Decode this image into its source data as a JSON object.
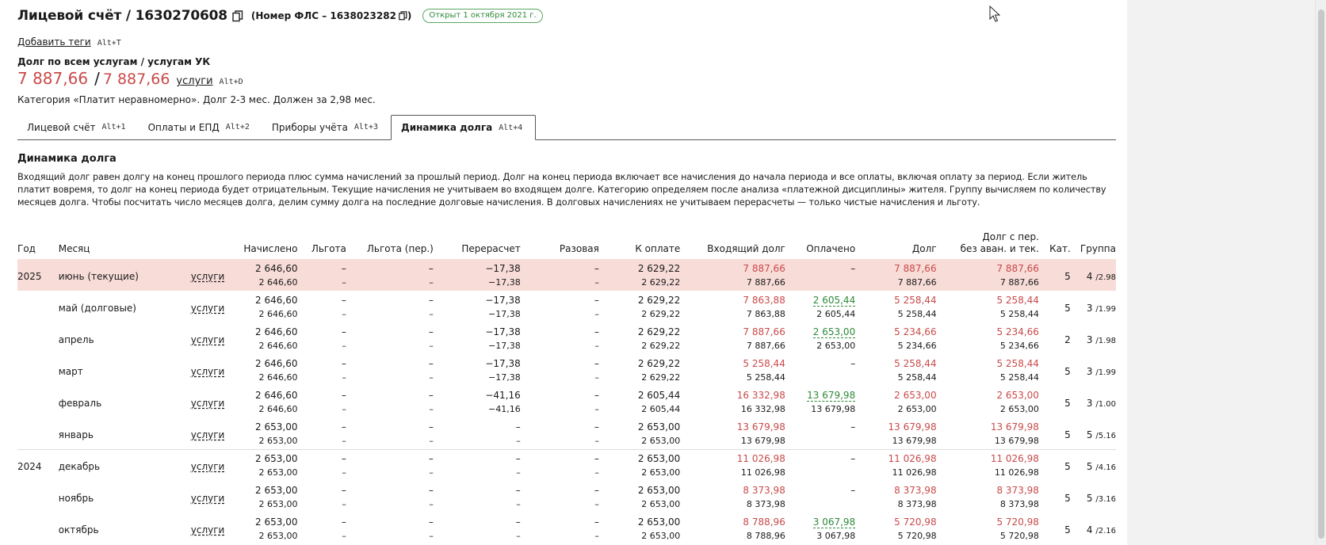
{
  "header": {
    "title": "Лицевой счёт / 1630270608",
    "fls_label": "(Номер ФЛС – 1638023282",
    "fls_close": ")",
    "opened_badge": "Открыт 1 октября 2021 г."
  },
  "tags": {
    "add_label": "Добавить теги",
    "hotkey": "Alt+T"
  },
  "debt": {
    "label": "Долг по всем услугам / услугам УК",
    "total": "7 887,66",
    "sep": "/",
    "uk": "7 887,66",
    "services_link": "услуги",
    "hotkey": "Alt+D",
    "category_text": "Категория «Платит неравномерно». Долг 2-3 мес. Должен за 2,98 мес."
  },
  "tabs": [
    {
      "label": "Лицевой счёт",
      "hotkey": "Alt+1"
    },
    {
      "label": "Оплаты и ЕПД",
      "hotkey": "Alt+2"
    },
    {
      "label": "Приборы учёта",
      "hotkey": "Alt+3"
    },
    {
      "label": "Динамика долга",
      "hotkey": "Alt+4"
    }
  ],
  "section": {
    "title": "Динамика долга",
    "description": "Входящий долг равен долгу на конец прошлого периода плюс сумма начислений за прошлый период. Долг на конец периода включает все начисления до начала периода и все оплаты, включая оплату за период. Если житель платит вовремя, то долг на конец периода будет отрицательным. Текущие начисления не учитываем во входящем долге. Категорию определяем после анализа «платежной дисциплины» жителя. Группу вычисляем по количеству месяцев долга. Чтобы посчитать число месяцев долга, делим сумму долга на последние долговые начисления. В долговых начислениях не учитываем перерасчеты — только чистые начисления и льготу."
  },
  "table": {
    "headers": {
      "year": "Год",
      "month": "Месяц",
      "charged": "Начислено",
      "benefit": "Льгота",
      "benefit_rec": "Льгота (пер.)",
      "recalc": "Перерасчет",
      "onetime": "Разовая",
      "to_pay": "К оплате",
      "incoming": "Входящий долг",
      "paid": "Оплачено",
      "debt": "Долг",
      "debt_adj_1": "Долг с пер.",
      "debt_adj_2": "без аван. и тек.",
      "cat": "Кат.",
      "group": "Группа"
    },
    "rows": [
      {
        "year": "2025",
        "month": "июнь (текущие)",
        "svc": "услуги",
        "charged": "2 646,60",
        "benefit": "–",
        "benefit_rec": "–",
        "recalc": "−17,38",
        "onetime": "–",
        "to_pay": "2 629,22",
        "incoming": "7 887,66",
        "paid": "–",
        "debt": "7 887,66",
        "debt_adj": "7 887,66",
        "cat": "5",
        "group_n": "4",
        "group_v": "/2.98",
        "sub": {
          "charged": "2 646,60",
          "benefit": "–",
          "benefit_rec": "–",
          "recalc": "−17,38",
          "onetime": "–",
          "to_pay": "2 629,22",
          "incoming": "7 887,66",
          "paid": "",
          "debt": "7 887,66",
          "debt_adj": "7 887,66"
        }
      },
      {
        "year": "",
        "month": "май (долговые)",
        "svc": "услуги",
        "charged": "2 646,60",
        "benefit": "–",
        "benefit_rec": "–",
        "recalc": "−17,38",
        "onetime": "–",
        "to_pay": "2 629,22",
        "incoming": "7 863,88",
        "paid": "2 605,44",
        "debt": "5 258,44",
        "debt_adj": "5 258,44",
        "cat": "5",
        "group_n": "3",
        "group_v": "/1.99",
        "sub": {
          "charged": "2 646,60",
          "benefit": "–",
          "benefit_rec": "–",
          "recalc": "−17,38",
          "onetime": "–",
          "to_pay": "2 629,22",
          "incoming": "7 863,88",
          "paid": "2 605,44",
          "debt": "5 258,44",
          "debt_adj": "5 258,44"
        }
      },
      {
        "year": "",
        "month": "апрель",
        "svc": "услуги",
        "charged": "2 646,60",
        "benefit": "–",
        "benefit_rec": "–",
        "recalc": "−17,38",
        "onetime": "–",
        "to_pay": "2 629,22",
        "incoming": "7 887,66",
        "paid": "2 653,00",
        "debt": "5 234,66",
        "debt_adj": "5 234,66",
        "cat": "2",
        "group_n": "3",
        "group_v": "/1.98",
        "sub": {
          "charged": "2 646,60",
          "benefit": "–",
          "benefit_rec": "–",
          "recalc": "−17,38",
          "onetime": "–",
          "to_pay": "2 629,22",
          "incoming": "7 887,66",
          "paid": "2 653,00",
          "debt": "5 234,66",
          "debt_adj": "5 234,66"
        }
      },
      {
        "year": "",
        "month": "март",
        "svc": "услуги",
        "charged": "2 646,60",
        "benefit": "–",
        "benefit_rec": "–",
        "recalc": "−17,38",
        "onetime": "–",
        "to_pay": "2 629,22",
        "incoming": "5 258,44",
        "paid": "–",
        "debt": "5 258,44",
        "debt_adj": "5 258,44",
        "cat": "5",
        "group_n": "3",
        "group_v": "/1.99",
        "sub": {
          "charged": "2 646,60",
          "benefit": "–",
          "benefit_rec": "–",
          "recalc": "−17,38",
          "onetime": "–",
          "to_pay": "2 629,22",
          "incoming": "5 258,44",
          "paid": "",
          "debt": "5 258,44",
          "debt_adj": "5 258,44"
        }
      },
      {
        "year": "",
        "month": "февраль",
        "svc": "услуги",
        "charged": "2 646,60",
        "benefit": "–",
        "benefit_rec": "–",
        "recalc": "−41,16",
        "onetime": "–",
        "to_pay": "2 605,44",
        "incoming": "16 332,98",
        "paid": "13 679,98",
        "debt": "2 653,00",
        "debt_adj": "2 653,00",
        "cat": "5",
        "group_n": "3",
        "group_v": "/1.00",
        "sub": {
          "charged": "2 646,60",
          "benefit": "–",
          "benefit_rec": "–",
          "recalc": "−41,16",
          "onetime": "–",
          "to_pay": "2 605,44",
          "incoming": "16 332,98",
          "paid": "13 679,98",
          "debt": "2 653,00",
          "debt_adj": "2 653,00"
        }
      },
      {
        "year": "",
        "month": "январь",
        "svc": "услуги",
        "charged": "2 653,00",
        "benefit": "–",
        "benefit_rec": "–",
        "recalc": "–",
        "onetime": "–",
        "to_pay": "2 653,00",
        "incoming": "13 679,98",
        "paid": "–",
        "debt": "13 679,98",
        "debt_adj": "13 679,98",
        "cat": "5",
        "group_n": "5",
        "group_v": "/5.16",
        "sub": {
          "charged": "2 653,00",
          "benefit": "–",
          "benefit_rec": "–",
          "recalc": "–",
          "onetime": "–",
          "to_pay": "2 653,00",
          "incoming": "13 679,98",
          "paid": "",
          "debt": "13 679,98",
          "debt_adj": "13 679,98"
        }
      },
      {
        "year": "2024",
        "month": "декабрь",
        "svc": "услуги",
        "charged": "2 653,00",
        "benefit": "–",
        "benefit_rec": "–",
        "recalc": "–",
        "onetime": "–",
        "to_pay": "2 653,00",
        "incoming": "11 026,98",
        "paid": "–",
        "debt": "11 026,98",
        "debt_adj": "11 026,98",
        "cat": "5",
        "group_n": "5",
        "group_v": "/4.16",
        "sub": {
          "charged": "2 653,00",
          "benefit": "–",
          "benefit_rec": "–",
          "recalc": "–",
          "onetime": "–",
          "to_pay": "2 653,00",
          "incoming": "11 026,98",
          "paid": "",
          "debt": "11 026,98",
          "debt_adj": "11 026,98"
        }
      },
      {
        "year": "",
        "month": "ноябрь",
        "svc": "услуги",
        "charged": "2 653,00",
        "benefit": "–",
        "benefit_rec": "–",
        "recalc": "–",
        "onetime": "–",
        "to_pay": "2 653,00",
        "incoming": "8 373,98",
        "paid": "–",
        "debt": "8 373,98",
        "debt_adj": "8 373,98",
        "cat": "5",
        "group_n": "5",
        "group_v": "/3.16",
        "sub": {
          "charged": "2 653,00",
          "benefit": "–",
          "benefit_rec": "–",
          "recalc": "–",
          "onetime": "–",
          "to_pay": "2 653,00",
          "incoming": "8 373,98",
          "paid": "",
          "debt": "8 373,98",
          "debt_adj": "8 373,98"
        }
      },
      {
        "year": "",
        "month": "октябрь",
        "svc": "услуги",
        "charged": "2 653,00",
        "benefit": "–",
        "benefit_rec": "–",
        "recalc": "–",
        "onetime": "–",
        "to_pay": "2 653,00",
        "incoming": "8 788,96",
        "paid": "3 067,98",
        "debt": "5 720,98",
        "debt_adj": "5 720,98",
        "cat": "5",
        "group_n": "4",
        "group_v": "/2.16",
        "sub": {
          "charged": "2 653,00",
          "benefit": "–",
          "benefit_rec": "–",
          "recalc": "–",
          "onetime": "–",
          "to_pay": "2 653,00",
          "incoming": "8 788,96",
          "paid": "3 067,98",
          "debt": "5 720,98",
          "debt_adj": "5 720,98"
        }
      }
    ]
  }
}
